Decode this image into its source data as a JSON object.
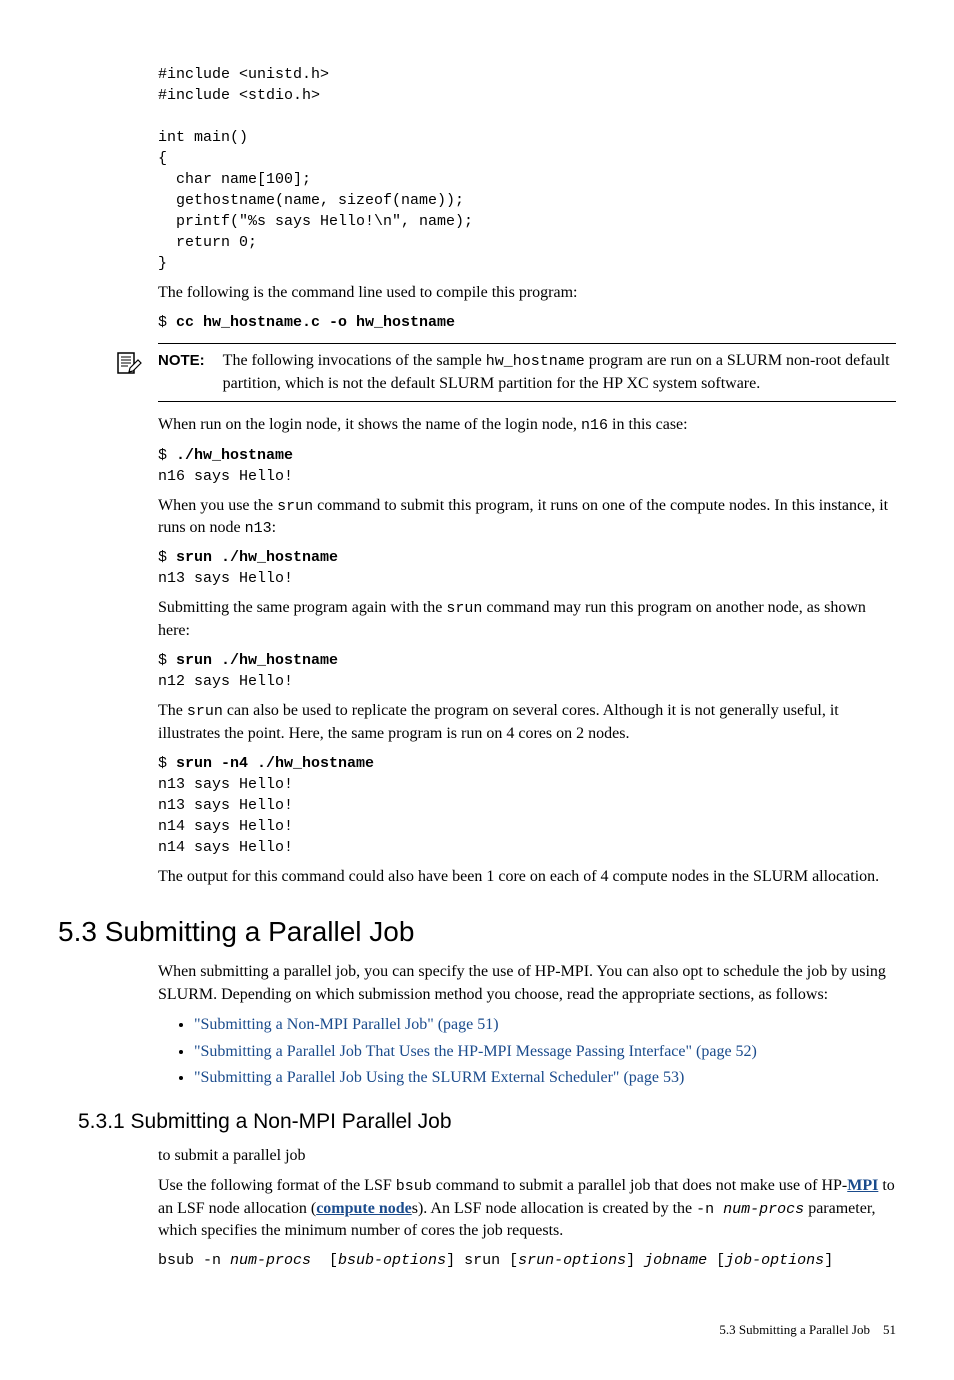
{
  "code1": "#include <unistd.h>\n#include <stdio.h>\n\nint main()\n{\n  char name[100];\n  gethostname(name, sizeof(name));\n  printf(\"%s says Hello!\\n\", name);\n  return 0;\n}",
  "p1": "The following is the command line used to compile this program:",
  "cmd1_prompt": "$ ",
  "cmd1_bold": "cc hw_hostname.c -o hw_hostname",
  "note_label": "NOTE:",
  "note_pre": "The following invocations of the sample ",
  "note_code": "hw_hostname",
  "note_post": " program are run on a SLURM non-root default partition, which is not the default SLURM partition for the HP XC system software.",
  "p2_a": "When run on the login node, it shows the name of the login node, ",
  "p2_code": "n16",
  "p2_b": " in this case:",
  "cmd2_prompt": "$ ",
  "cmd2_bold": "./hw_hostname",
  "cmd2_out": "n16 says Hello!",
  "p3_a": "When you use the ",
  "p3_code": "srun",
  "p3_b": " command to submit this program, it runs on one of the compute nodes. In this instance, it runs on node ",
  "p3_code2": "n13",
  "p3_c": ":",
  "cmd3_prompt": "$ ",
  "cmd3_bold": "srun ./hw_hostname",
  "cmd3_out": "n13 says Hello!",
  "p4_a": "Submitting the same program again with the ",
  "p4_code": "srun",
  "p4_b": " command may run this program on another node, as shown here:",
  "cmd4_prompt": "$ ",
  "cmd4_bold": "srun ./hw_hostname",
  "cmd4_out": "n12 says Hello!",
  "p5_a": "The ",
  "p5_code": "srun",
  "p5_b": " can also be used to replicate the program on several cores. Although it is not generally useful, it illustrates the point. Here, the same program is run on 4 cores on 2 nodes.",
  "cmd5_prompt": "$ ",
  "cmd5_bold": "srun -n4 ./hw_hostname",
  "cmd5_out": "n13 says Hello!\nn13 says Hello!\nn14 says Hello!\nn14 says Hello!",
  "p6": "The output for this command could also have been 1 core on each of 4 compute nodes in the SLURM allocation.",
  "h2": "5.3 Submitting a Parallel Job",
  "p7": "When submitting a parallel job, you can specify the use of HP-MPI. You can also opt to schedule the job by using SLURM. Depending on which submission method you choose, read the appropriate sections, as follows:",
  "li1": "\"Submitting a Non-MPI Parallel Job\" (page 51)",
  "li2": "\"Submitting a Parallel Job That Uses the HP-MPI Message Passing Interface\" (page 52)",
  "li3": "\"Submitting a Parallel Job Using the SLURM External Scheduler\" (page 53)",
  "h3": "5.3.1 Submitting a Non-MPI Parallel Job",
  "p8": "to submit a parallel job",
  "p9_a": "Use the following format of the LSF ",
  "p9_code1": "bsub",
  "p9_b": " command to submit a parallel job that does not make use of HP-",
  "p9_gloss1": "MPI",
  "p9_c": " to an LSF node allocation (",
  "p9_gloss2": "compute node",
  "p9_d": "s). An LSF node allocation is created by the ",
  "p9_code2": "-n",
  "p9_space": " ",
  "p9_ital": "num-procs",
  "p9_e": " parameter, which specifies the minimum number of cores the job requests.",
  "syntax_a": "bsub -n ",
  "syntax_b": "num-procs",
  "syntax_c": "  [",
  "syntax_d": "bsub-options",
  "syntax_e": "] srun [",
  "syntax_f": "srun-options",
  "syntax_g": "] ",
  "syntax_h": "jobname",
  "syntax_i": " [",
  "syntax_j": "job-options",
  "syntax_k": "]",
  "footer_text": "5.3 Submitting a Parallel Job",
  "footer_page": "51"
}
